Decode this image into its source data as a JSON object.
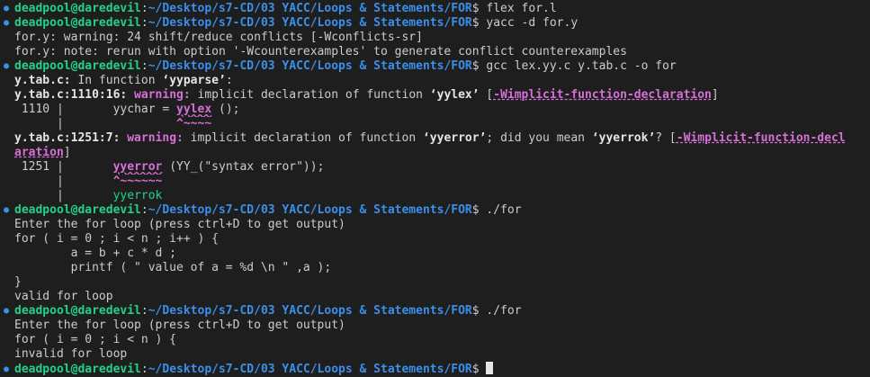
{
  "prompt": {
    "user": "deadpool@daredevil",
    "sep": ":",
    "cwd": "~/Desktop/s7-CD/03 YACC/Loops & Statements/FOR",
    "symbol": "$ "
  },
  "commands": [
    "flex for.l",
    "yacc -d for.y",
    "gcc lex.yy.c y.tab.c -o for",
    "./for",
    "./for"
  ],
  "yacc_output": [
    "for.y: warning: 24 shift/reduce conflicts [-Wconflicts-sr]",
    "for.y: note: rerun with option '-Wcounterexamples' to generate conflict counterexamples"
  ],
  "gcc": {
    "in_function_file": "y.tab.c:",
    "in_function_text": " In function ",
    "in_function_name": "‘yyparse’",
    "in_function_end": ":",
    "warn1": {
      "loc": "y.tab.c:1110:16:",
      "label": " warning:",
      "msg_a": " implicit declaration of function ",
      "func": "‘yylex’",
      "msg_b": " [",
      "flag": "-Wimplicit-function-declaration",
      "close": "]",
      "src_lineno": " 1110 |",
      "src_pre": "       yychar = ",
      "src_hl": "yylex",
      "src_post": " ();",
      "bar": "      |",
      "caret_pad": "                ",
      "caret": "^~~~~"
    },
    "warn2": {
      "loc": "y.tab.c:1251:7:",
      "label": " warning:",
      "msg_a": " implicit declaration of function ",
      "func": "‘yyerror’",
      "msg_b": "; did you mean ",
      "suggest": "‘yyerrok’",
      "msg_c": "? [",
      "flag_part1": "-Wimplicit-function-decl",
      "flag_part2": "aration",
      "close": "]",
      "src_lineno": " 1251 |",
      "src_pre": "       ",
      "src_hl": "yyerror",
      "src_post": " (YY_(\"syntax error\"));",
      "bar": "      |",
      "caret_pad": "       ",
      "caret": "^~~~~~~",
      "fix_pad": "       ",
      "fix": "yyerrok"
    }
  },
  "run1": [
    "Enter the for loop (press ctrl+D to get output)",
    "for ( i = 0 ; i < n ; i++ ) {",
    "        a = b + c * d ;",
    "        printf ( \" value of a = %d \\n \" ,a );",
    "}",
    "valid for loop"
  ],
  "run2": [
    "Enter the for loop (press ctrl+D to get output)",
    "for ( i = 0 ; i < n ) {",
    "invalid for loop"
  ],
  "colors": {
    "background": "#1e1e1e",
    "foreground": "#cccccc",
    "user": "#23d18b",
    "path": "#3b8eea",
    "warning": "#d670d6",
    "suggestion": "#23d18b"
  }
}
